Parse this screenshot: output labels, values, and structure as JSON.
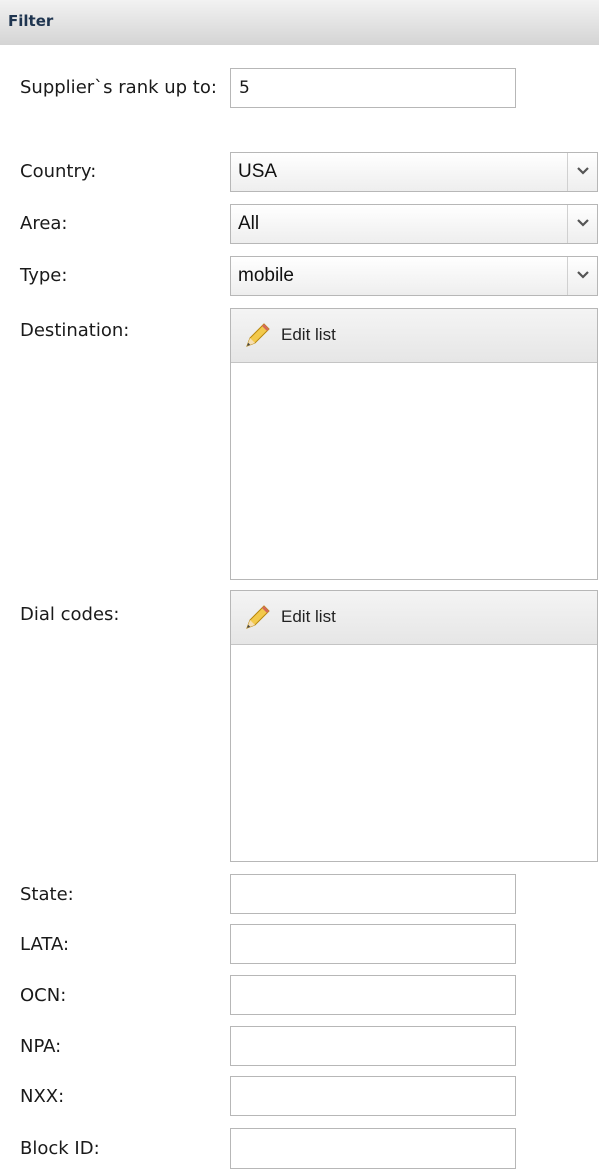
{
  "panel": {
    "title": "Filter"
  },
  "fields": {
    "rank": {
      "label": "Supplier`s rank up to:",
      "value": "5"
    },
    "country": {
      "label": "Country:",
      "value": "USA"
    },
    "area": {
      "label": "Area:",
      "value": "All"
    },
    "type": {
      "label": "Type:",
      "value": "mobile"
    },
    "destination": {
      "label": "Destination:",
      "edit_label": "Edit list"
    },
    "dial_codes": {
      "label": "Dial codes:",
      "edit_label": "Edit list"
    },
    "state": {
      "label": "State:",
      "value": ""
    },
    "lata": {
      "label": "LATA:",
      "value": ""
    },
    "ocn": {
      "label": "OCN:",
      "value": ""
    },
    "npa": {
      "label": "NPA:",
      "value": ""
    },
    "nxx": {
      "label": "NXX:",
      "value": ""
    },
    "block_id": {
      "label": "Block ID:",
      "value": ""
    }
  }
}
